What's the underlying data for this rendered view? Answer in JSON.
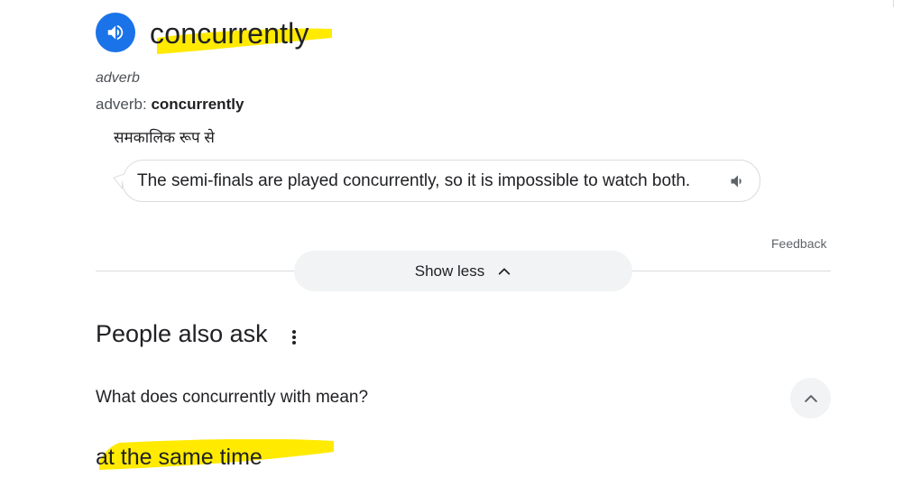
{
  "definition": {
    "word": "concurrently",
    "part_of_speech": "adverb",
    "pos_label": "adverb",
    "pos_separator": ": ",
    "pos_word": "concurrently",
    "translation": "समकालिक रूप से",
    "example": "The semi-finals are played concurrently, so it is impossible to watch both."
  },
  "feedback_label": "Feedback",
  "show_less_label": "Show less",
  "people_also_ask": {
    "title": "People also ask",
    "question": "What does concurrently with mean?",
    "answer": "at the same time"
  },
  "colors": {
    "accent": "#1a73e8",
    "highlight": "#ffea00",
    "chip_bg": "#f1f3f4"
  },
  "icons": {
    "audio": "speaker-icon",
    "example_audio": "speaker-icon",
    "show_less": "chevron-up-icon",
    "more": "more-vert-icon",
    "question_toggle": "chevron-up-icon"
  }
}
